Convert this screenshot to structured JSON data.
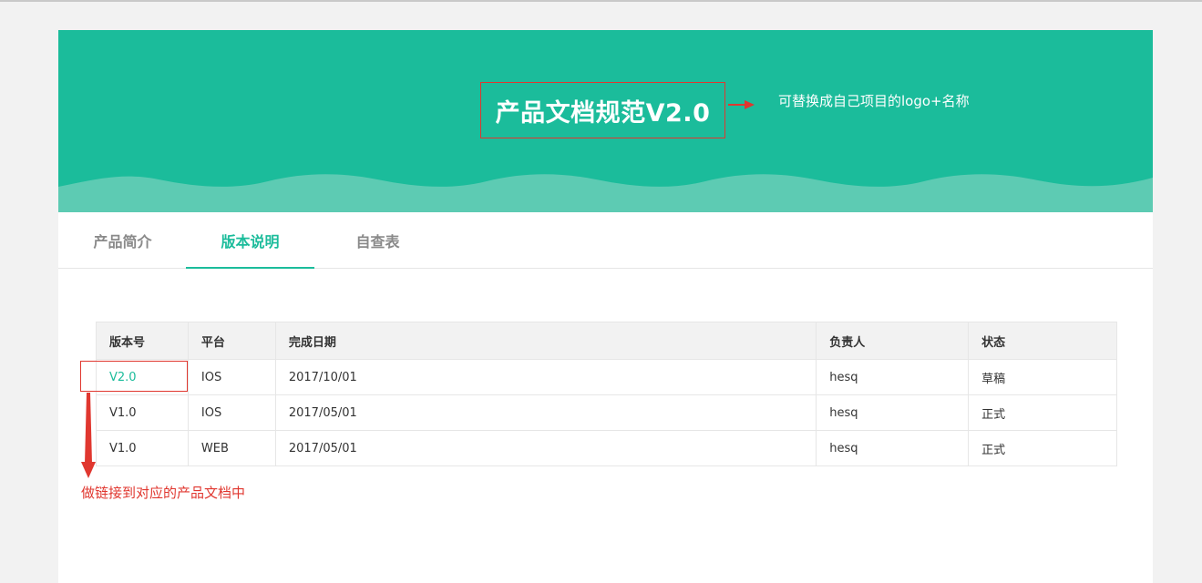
{
  "header": {
    "title": "产品文档规范V2.0",
    "note": "可替换成自己项目的logo+名称"
  },
  "tabs": [
    {
      "label": "产品简介",
      "active": false
    },
    {
      "label": "版本说明",
      "active": true
    },
    {
      "label": "自查表",
      "active": false
    }
  ],
  "table": {
    "columns": [
      "版本号",
      "平台",
      "完成日期",
      "负责人",
      "状态"
    ],
    "rows": [
      {
        "version": "V2.0",
        "platform": "IOS",
        "date": "2017/10/01",
        "owner": "hesq",
        "status": "草稿"
      },
      {
        "version": "V1.0",
        "platform": "IOS",
        "date": "2017/05/01",
        "owner": "hesq",
        "status": "正式"
      },
      {
        "version": "V1.0",
        "platform": "WEB",
        "date": "2017/05/01",
        "owner": "hesq",
        "status": "正式"
      }
    ]
  },
  "annotations": {
    "link_note": "做链接到对应的产品文档中"
  },
  "colors": {
    "brand": "#1bbc9b",
    "wave": "#5dcbb3",
    "annotation_red": "#e0372f"
  }
}
